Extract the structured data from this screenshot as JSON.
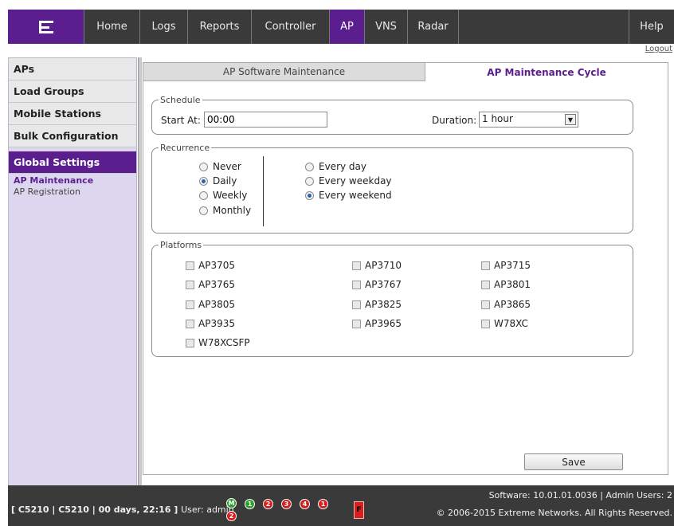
{
  "nav": {
    "logo": "E",
    "items": [
      "Home",
      "Logs",
      "Reports",
      "Controller",
      "AP",
      "VNS",
      "Radar"
    ],
    "active": "AP",
    "help": "Help",
    "logout": "Logout"
  },
  "sidebar": {
    "items": [
      "APs",
      "Load Groups",
      "Mobile Stations",
      "Bulk Configuration"
    ],
    "active_section": "Global Settings",
    "sub_items": [
      "AP Maintenance",
      "AP Registration"
    ]
  },
  "tabs": [
    "AP Software Maintenance",
    "AP Maintenance Cycle"
  ],
  "schedule": {
    "legend": "Schedule",
    "start_label": "Start At:",
    "start_value": "00:00",
    "duration_label": "Duration:",
    "duration_value": "1 hour"
  },
  "recurrence": {
    "legend": "Recurrence",
    "left_options": [
      "Never",
      "Daily",
      "Weekly",
      "Monthly"
    ],
    "right_options": [
      "Every day",
      "Every weekday",
      "Every weekend"
    ],
    "selected_left": "Daily",
    "selected_right": "Every weekend"
  },
  "platforms": {
    "legend": "Platforms",
    "col1": [
      "AP3705",
      "AP3765",
      "AP3805",
      "AP3935",
      "W78XCSFP"
    ],
    "col2": [
      "AP3710",
      "AP3767",
      "AP3825",
      "AP3965"
    ],
    "col3": [
      "AP3715",
      "AP3801",
      "AP3865",
      "W78XC"
    ]
  },
  "save_label": "Save",
  "footer": {
    "session": "[ C5210 | C5210 | 00 days, 22:16 ]",
    "user": "User: admin",
    "software": "Software: 10.01.01.0036 | Admin Users: 2",
    "copyright": "© 2006-2015  Extreme Networks. All Rights Reserved.",
    "status_icons": [
      "M",
      "1",
      "2",
      "3",
      "4",
      "1"
    ],
    "sub_badge": "2",
    "flag": "F"
  },
  "colors": {
    "brand": "#5b1e8e",
    "nav_bg": "#3a3a3a",
    "sidebar_bg": "#ddd6ef",
    "status_green": "#2fa02f",
    "status_red": "#d21f1f"
  }
}
